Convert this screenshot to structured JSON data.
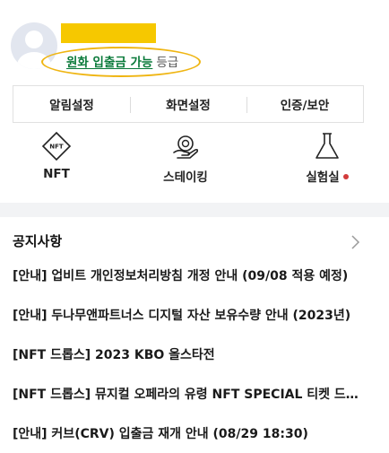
{
  "profile": {
    "grade_link": "원화 입출금 가능",
    "grade_suffix": "등급"
  },
  "settings": {
    "notifications": "알림설정",
    "display": "화면설정",
    "security": "인증/보안"
  },
  "shortcuts": {
    "nft": {
      "label": "NFT",
      "icon": "nft-diamond-icon"
    },
    "staking": {
      "label": "스테이킹",
      "icon": "staking-coin-icon"
    },
    "lab": {
      "label": "실험실",
      "icon": "flask-icon",
      "has_new": true
    }
  },
  "notices": {
    "title": "공지사항",
    "items": [
      "[안내] 업비트 개인정보처리방침 개정 안내 (09/08 적용 예정)",
      "[안내] 두나무앤파트너스 디지털 자산 보유수량 안내 (2023년)",
      "[NFT 드롭스] 2023 KBO 올스타전",
      "[NFT 드롭스] 뮤지컬 오페라의 유령 NFT SPECIAL 티켓 드롭스",
      "[안내] 커브(CRV) 입출금 재개 안내 (08/29 18:30)"
    ]
  },
  "colors": {
    "grade_link": "#0a7a3a",
    "highlight_ring": "#efb512",
    "name_mask": "#f6c800",
    "new_dot": "#d23b3b"
  }
}
